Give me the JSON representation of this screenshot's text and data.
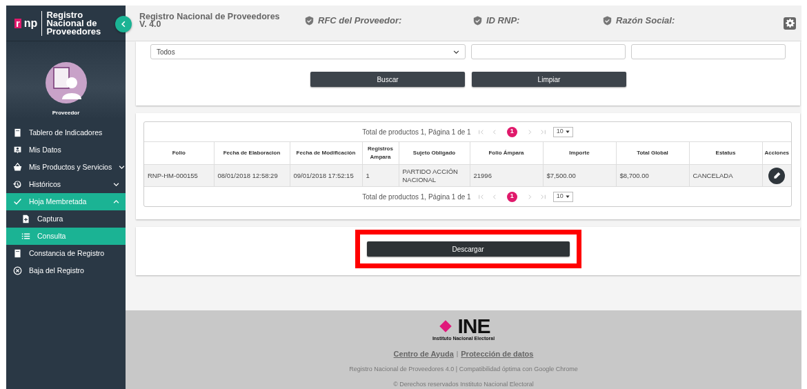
{
  "sidebar": {
    "logo": {
      "mark": "r",
      "text": "np"
    },
    "brand": "Registro Nacional de Proveedores",
    "profile": "Proveedor",
    "items": [
      {
        "label": "Tablero de Indicadores",
        "selected": false
      },
      {
        "label": "Mis Datos",
        "selected": false
      },
      {
        "label": "Mis Productos y Servicios",
        "selected": false,
        "expanded": false
      },
      {
        "label": "Históricos",
        "selected": false,
        "expanded": false
      },
      {
        "label": "Hoja Membretada",
        "selected": true,
        "expanded": true,
        "children": [
          {
            "label": "Captura",
            "selected": false
          },
          {
            "label": "Consulta",
            "selected": true
          }
        ]
      },
      {
        "label": "Constancia de Registro",
        "selected": false
      },
      {
        "label": "Baja del Registro",
        "selected": false
      }
    ]
  },
  "header": {
    "title": "Registro Nacional de Proveedores V. 4.0",
    "fields": [
      "RFC del Proveedor:",
      "ID RNP:",
      "Razón Social:"
    ]
  },
  "filters": {
    "select_value": "Todos",
    "buttons": [
      "Buscar",
      "Limpiar"
    ]
  },
  "table": {
    "pager_top": {
      "summary": "Total de productos 1, Página 1 de 1",
      "page": "1",
      "per_page": "10"
    },
    "pager_bottom": {
      "summary": "Total de productos 1, Página 1 de 1",
      "page": "1",
      "per_page": "10"
    },
    "columns": [
      "Folio",
      "Fecha de Elaboracion",
      "Fecha de Modificación",
      "Registros Ampara",
      "Sujeto Obligado",
      "Folio Ámpara",
      "Importe",
      "Total Global",
      "Estatus",
      "Acciones"
    ],
    "rows": [
      [
        "RNP-HM-000155",
        "08/01/2018 12:58:29",
        "09/01/2018 17:52:15",
        "1",
        "PARTIDO ACCIÓN NACIONAL",
        "21996",
        "$7,500.00",
        "$8,700.00",
        "CANCELADA"
      ]
    ]
  },
  "download": {
    "label": "Descargar",
    "highlighted": true
  },
  "footer": {
    "logo": "INE",
    "logo_caption": "Instituto Nacional Electoral",
    "links": [
      "Centro de Ayuda",
      "Protección de datos"
    ],
    "separator": "|",
    "note": "Registro Nacional de Proveedores 4.0 | Compatibilidad óptima con Google Chrome",
    "copyright": "© Derechos reservados Instituto Nacional Electoral"
  }
}
